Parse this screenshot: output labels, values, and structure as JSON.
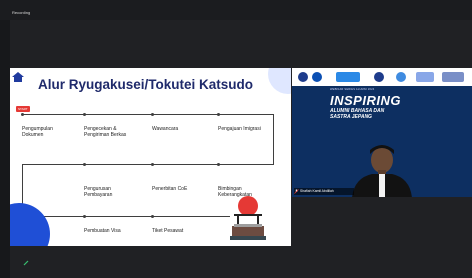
{
  "window": {
    "recording_label": "Recording",
    "time": ""
  },
  "slide": {
    "title": "Alur Ryugakusei/Tokutei Katsudo",
    "start_label": "START",
    "steps": [
      {
        "label": "Pengumpulan Dokumen"
      },
      {
        "label": "Pengecekan & Pengiriman Berkas"
      },
      {
        "label": "Wawancara"
      },
      {
        "label": "Pengajuan Imigrasi"
      },
      {
        "label": "Pengurusan Pembayaran"
      },
      {
        "label": "Penerbitan CoE"
      },
      {
        "label": "Bimbingan Keberangkatan"
      },
      {
        "label": "Pembuatan Visa"
      },
      {
        "label": "Tiket Pesawat"
      }
    ]
  },
  "video": {
    "event_top": "WEBINAR SERIES ALUMNI 2024",
    "event_title": "INSPIRING",
    "event_sub_1": "ALUMNI BAHASA DAN",
    "event_sub_2": "SASTRA JEPANG",
    "participant_name": "Shafiah Kamil Abdillah",
    "logos": [
      "fib-logo",
      "ub-logo",
      "kampus-merdeka-logo",
      "partner-logo"
    ]
  },
  "icons": {
    "home": "home-icon",
    "mic": "mic-muted-icon",
    "pin": "pin-icon"
  },
  "colors": {
    "slide_title": "#1f2a6b",
    "accent_blue": "#1f4fd6",
    "event_bg": "#0d2f61"
  }
}
